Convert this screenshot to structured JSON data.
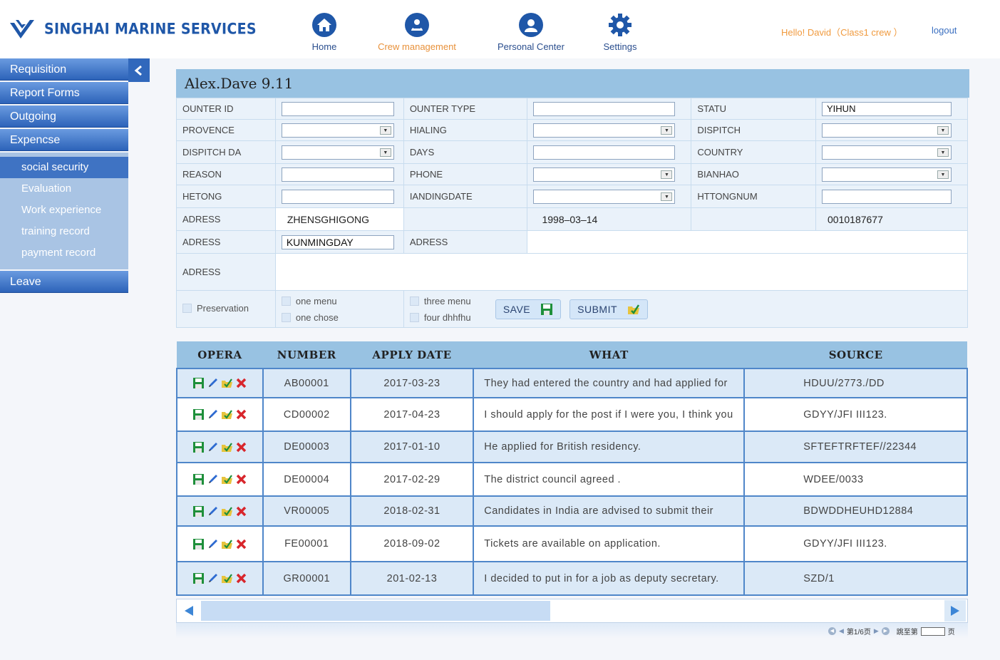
{
  "brand": {
    "name": "SINGHAI MARINE SERVICES"
  },
  "nav": [
    {
      "label": "Home",
      "icon": "home-icon"
    },
    {
      "label": "Crew management",
      "icon": "crew-icon"
    },
    {
      "label": "Personal Center",
      "icon": "user-icon"
    },
    {
      "label": "Settings",
      "icon": "gear-icon"
    }
  ],
  "user": {
    "greeting": "Hello!  David（Class1  crew ）",
    "logout": "logout"
  },
  "sidebar": {
    "main_top": [
      "Requisition",
      "Report Forms",
      "Outgoing",
      "Expencse"
    ],
    "sub": [
      "social security",
      "Evaluation",
      "Work experience",
      "training record",
      "payment record"
    ],
    "main_bottom": [
      "Leave"
    ]
  },
  "form": {
    "title": "Alex.Dave  9.11",
    "labels": {
      "ounter_id": "OUNTER ID",
      "ounter_type": "OUNTER TYPE",
      "statu": "STATU",
      "provence": "PROVENCE",
      "hialing": "HIALING",
      "dispitch": "DISPITCH",
      "dispitch_da": "DISPITCH DA",
      "days": "DAYS",
      "country": "COUNTRY",
      "reason": "REASON",
      "phone": "PHONE",
      "bianhao": "BIANHAO",
      "hetong": "HETONG",
      "iandingdate": "IANDINGDATE",
      "httongnum": "HTTONGNUM",
      "adress": "ADRESS"
    },
    "values": {
      "statu": "YIHUN",
      "adress1_a": "ZHENSGHIGONG",
      "adress1_b": "1998–03–14",
      "adress1_c": "0010187677",
      "adress2": "KUNMINGDAY"
    },
    "options": {
      "preservation": "Preservation",
      "one_menu": "one menu",
      "one_chose": "one chose",
      "three_menu": "three menu",
      "four": "four dhhfhu"
    },
    "save": "SAVE",
    "submit": "SUBMIT"
  },
  "table": {
    "headers": [
      "OPERA",
      "NUMBER",
      "APPLY DATE",
      "WHAT",
      "SOURCE"
    ],
    "rows": [
      {
        "number": "AB00001",
        "date": "2017-03-23",
        "what": "They had entered the country and had applied for",
        "source": "HDUU/2773./DD"
      },
      {
        "number": "CD00002",
        "date": "2017-04-23",
        "what": "I should apply for the post if I were you, I think you",
        "source": "GDYY/JFI III123."
      },
      {
        "number": "DE00003",
        "date": "2017-01-10",
        "what": "He applied for British residency.",
        "source": "SFTEFTRFTEF//22344"
      },
      {
        "number": "DE00004",
        "date": "2017-02-29",
        "what": "The district council agreed .",
        "source": "WDEE/0033"
      },
      {
        "number": "VR00005",
        "date": "2018-02-31",
        "what": "Candidates in India are advised to submit their",
        "source": "BDWDDHEUHD12884"
      },
      {
        "number": "FE00001",
        "date": "2018-09-02",
        "what": "Tickets are available on application.",
        "source": "GDYY/JFI III123."
      },
      {
        "number": "GR00001",
        "date": "201-02-13",
        "what": "I decided to put in for a job as deputy secretary.",
        "source": "SZD/1"
      }
    ]
  },
  "pager": {
    "page_info": "第1/6页",
    "jump_to": "跳至第",
    "page_unit": "页"
  },
  "colors": {
    "brand": "#1f57a8",
    "accent": "#f09a3e",
    "header_band": "#98c2e2",
    "row_alt": "#dbe9f7"
  }
}
